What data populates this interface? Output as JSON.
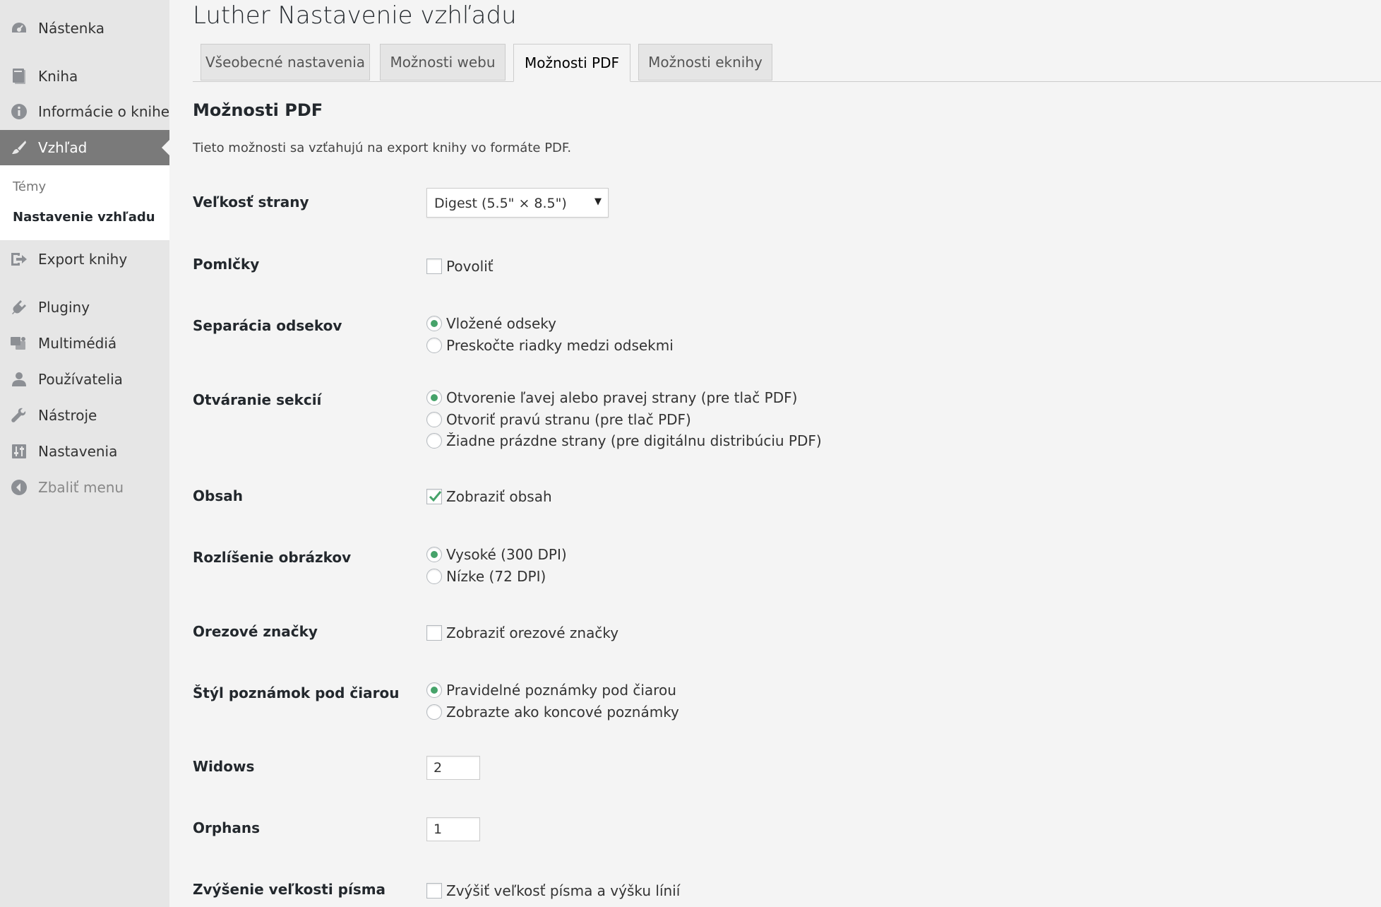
{
  "sidebar": {
    "items": [
      {
        "label": "Nástenka",
        "icon": "dashboard-icon"
      },
      {
        "label": "Kniha",
        "icon": "book-icon"
      },
      {
        "label": "Informácie o knihe",
        "icon": "info-icon"
      },
      {
        "label": "Vzhľad",
        "icon": "paintbrush-icon"
      },
      {
        "label": "Export knihy",
        "icon": "export-icon"
      },
      {
        "label": "Pluginy",
        "icon": "plugin-icon"
      },
      {
        "label": "Multimédiá",
        "icon": "media-icon"
      },
      {
        "label": "Používatelia",
        "icon": "user-icon"
      },
      {
        "label": "Nástroje",
        "icon": "wrench-icon"
      },
      {
        "label": "Nastavenia",
        "icon": "settings-icon"
      },
      {
        "label": "Zbaliť menu",
        "icon": "collapse-icon"
      }
    ],
    "submenu": [
      "Témy",
      "Nastavenie vzhľadu"
    ]
  },
  "page": {
    "title": "Luther Nastavenie vzhľadu",
    "tabs": [
      "Všeobecné nastavenia",
      "Možnosti webu",
      "Možnosti PDF",
      "Možnosti eknihy"
    ],
    "active_tab": "Možnosti PDF",
    "section_title": "Možnosti PDF",
    "section_desc": "Tieto možnosti sa vzťahujú na export knihy vo formáte PDF."
  },
  "form": {
    "page_size": {
      "label": "Veľkosť strany",
      "value": "Digest (5.5\" × 8.5\")"
    },
    "hyphens": {
      "label": "Pomlčky",
      "option": "Povoliť",
      "checked": false
    },
    "paragraph_separation": {
      "label": "Separácia odsekov",
      "options": [
        "Vložené odseky",
        "Preskočte riadky medzi odsekmi"
      ],
      "selected": 0
    },
    "section_openings": {
      "label": "Otváranie sekcií",
      "options": [
        "Otvorenie ľavej alebo pravej strany (pre tlač PDF)",
        "Otvoriť pravú stranu (pre tlač PDF)",
        "Žiadne prázdne strany (pre digitálnu distribúciu PDF)"
      ],
      "selected": 0
    },
    "toc": {
      "label": "Obsah",
      "option": "Zobraziť obsah",
      "checked": true
    },
    "image_resolution": {
      "label": "Rozlíšenie obrázkov",
      "options": [
        "Vysoké (300 DPI)",
        "Nízke (72 DPI)"
      ],
      "selected": 0
    },
    "crop_marks": {
      "label": "Orezové značky",
      "option": "Zobraziť orezové značky",
      "checked": false
    },
    "footnote_style": {
      "label": "Štýl poznámok pod čiarou",
      "options": [
        "Pravidelné poznámky pod čiarou",
        "Zobrazte ako koncové poznámky"
      ],
      "selected": 0
    },
    "widows": {
      "label": "Widows",
      "value": "2"
    },
    "orphans": {
      "label": "Orphans",
      "value": "1"
    },
    "font_size": {
      "label": "Zvýšenie veľkosti písma",
      "option": "Zvýšiť veľkosť písma a výšku línií",
      "checked": false
    }
  },
  "colors": {
    "accent_green": "#46a36a",
    "sidebar_bg": "#e6e6e6",
    "active_menu_bg": "#7a7a7a"
  }
}
